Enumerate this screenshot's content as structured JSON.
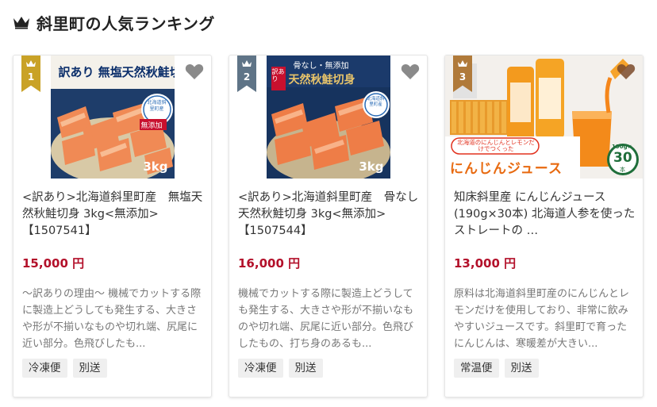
{
  "header": {
    "title": "斜里町の人気ランキング",
    "icon": "crown-icon",
    "icon_color": "#222222"
  },
  "cards": [
    {
      "rank": "1",
      "rank_color": "#c9a227",
      "image_text_main": "訳あり 無塩天然秋鮭切身",
      "image_text_weight": "3kg",
      "image_text_badge": "無添加",
      "image_text_seal": "北海道斜里町産",
      "title": "<訳あり>北海道斜里町産　無塩天然秋鮭切身 3kg<無添加>【1507541】",
      "price": "15,000 円",
      "desc": "～訳ありの理由～ 機械でカットする際に製造上どうしても発生する、大きさや形が不揃いなものや切れ端、尻尾に近い部分。色飛びしたも...",
      "tags": [
        "冷凍便",
        "別送"
      ]
    },
    {
      "rank": "2",
      "rank_color": "#5f7487",
      "image_text_main": "天然秋鮭切身",
      "image_text_weight": "3kg",
      "image_text_badge": "訳あり",
      "image_text_top": "骨なし・無添加",
      "image_text_seal": "北海道斜里町産",
      "title": "<訳あり>北海道斜里町産　骨なし天然秋鮭切身 3kg<無添加>【1507544】",
      "price": "16,000 円",
      "desc": "機械でカットする際に製造上どうしても発生する、大きさや形が不揃いなものや切れ端、尻尾に近い部分。色飛びしたもの、打ち身のあるも...",
      "tags": [
        "冷凍便",
        "別送"
      ]
    },
    {
      "rank": "3",
      "rank_color": "#b07a3a",
      "image_text_main": "にんじんジュース",
      "image_text_caption": "北海道のにんじんとレモンだけでつくった",
      "image_text_count": "30",
      "image_text_unit": "190g×",
      "image_text_count_unit": "本",
      "title": "知床斜里産 にんじんジュース (190g×30本) 北海道人参を使ったストレートの …",
      "price": "13,000 円",
      "desc": "原料は北海道斜里町産のにんじんとレモンだけを使用しており、非常に飲みやすいジュースです。斜里町で育ったにんじんは、寒暖差が大きい...",
      "tags": [
        "常温便",
        "別送"
      ]
    }
  ]
}
